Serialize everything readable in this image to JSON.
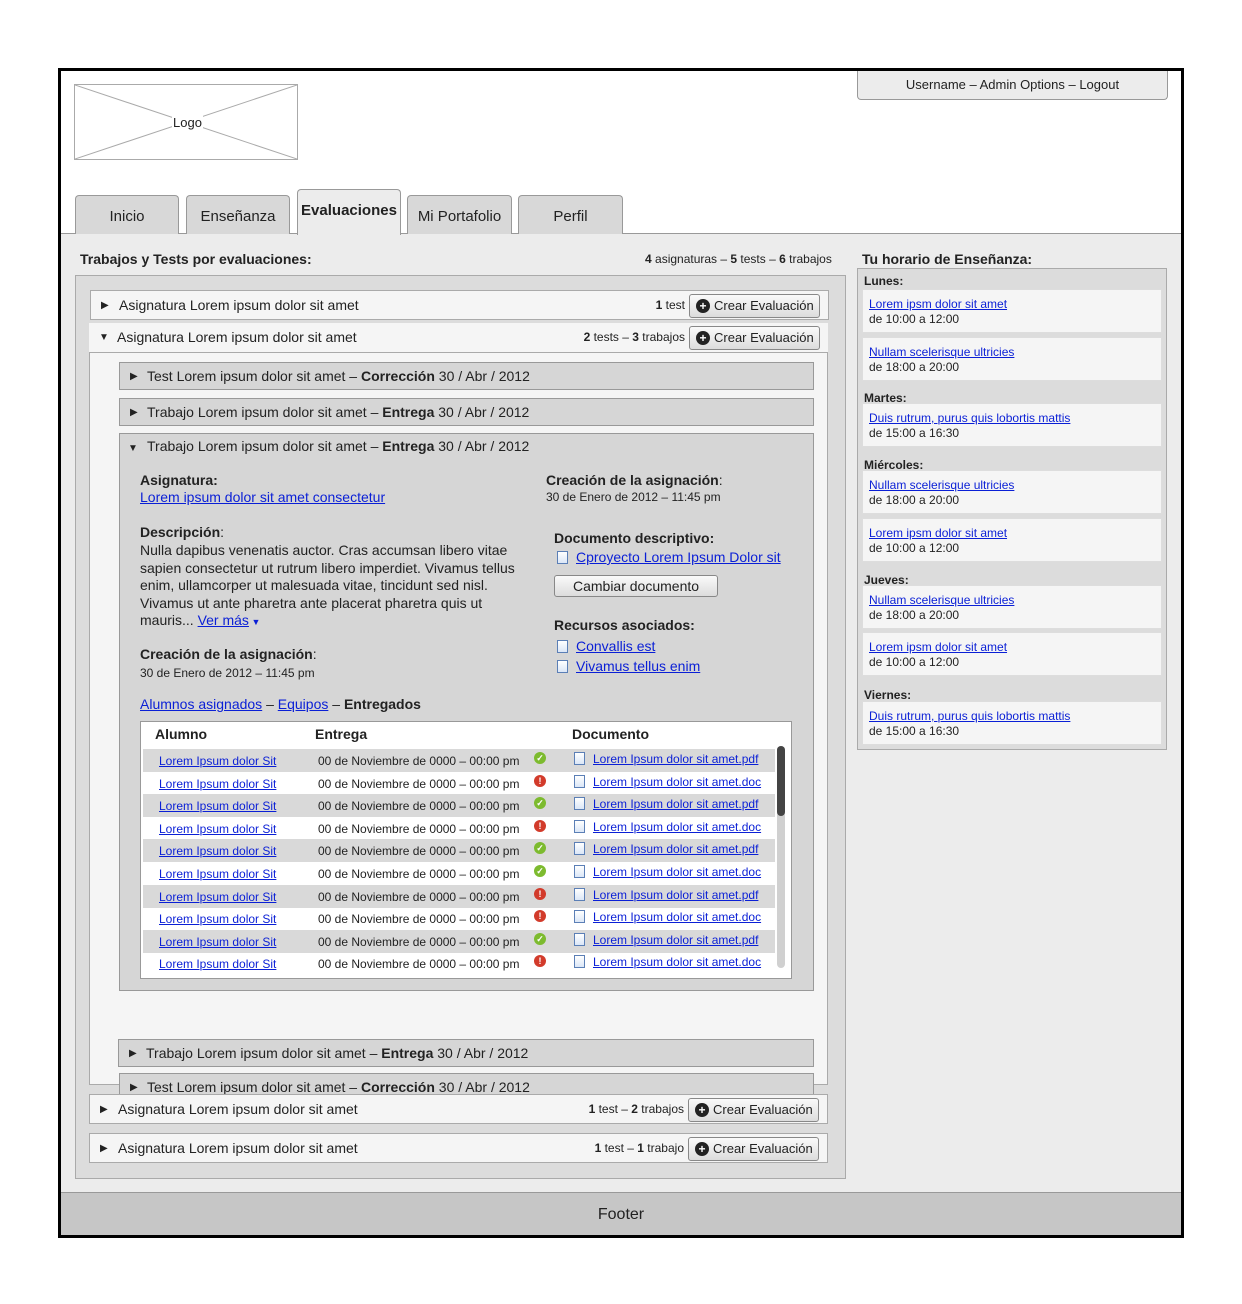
{
  "header": {
    "logo_label": "Logo",
    "user_links": "Username – Admin Options – Logout"
  },
  "tabs": [
    {
      "label": "Inicio"
    },
    {
      "label": "Enseñanza"
    },
    {
      "label": "Evaluaciones"
    },
    {
      "label": "Mi Portafolio"
    },
    {
      "label": "Perfil"
    }
  ],
  "main": {
    "title": "Trabajos y Tests por evaluaciones:",
    "summary": {
      "n1": "4",
      "t1": " asignaturas – ",
      "n2": "5",
      "t2": " tests – ",
      "n3": "6",
      "t3": " trabajos"
    },
    "subjects": [
      {
        "title": "Asignatura Lorem ipsum dolor sit amet",
        "n1": "1",
        "t1": " test",
        "n2": "",
        "t2": "",
        "button": "Crear Evaluación"
      },
      {
        "title": "Asignatura Lorem ipsum dolor sit amet",
        "n1": "2",
        "t1": " tests – ",
        "n2": "3",
        "t2": " trabajos",
        "button": "Crear Evaluación"
      },
      {
        "title": "Asignatura Lorem ipsum dolor sit amet",
        "n1": "1",
        "t1": " test – ",
        "n2": "2",
        "t2": " trabajos",
        "button": "Crear Evaluación"
      },
      {
        "title": "Asignatura Lorem ipsum dolor sit amet",
        "n1": "1",
        "t1": " test – ",
        "n2": "1",
        "t2": " trabajo",
        "button": "Crear Evaluación"
      }
    ],
    "items": [
      {
        "prefix": "Test Lorem ipsum dolor sit amet – ",
        "kind": "Corrección",
        "date": " 30 / Abr / 2012"
      },
      {
        "prefix": "Trabajo Lorem ipsum dolor sit amet – ",
        "kind": "Entrega",
        "date": " 30 / Abr / 2012"
      },
      {
        "prefix": "Test Lorem ipsum dolor sit amet – ",
        "kind": "Corrección",
        "date": " 30 / Abr / 2012"
      },
      {
        "prefix": "Trabajo Lorem ipsum dolor sit amet – ",
        "kind": "Entrega",
        "date": " 30 / Abr / 2012"
      }
    ],
    "detail": {
      "prefix": "Trabajo Lorem ipsum dolor sit amet  – ",
      "kind": "Entrega",
      "date": " 30 / Abr / 2012",
      "asignatura_label": "Asignatura:",
      "asignatura_link": "Lorem ipsum dolor sit amet consectetur",
      "descripcion_label": "Descripción",
      "descripcion_text": "Nulla dapibus venenatis auctor. Cras accumsan libero vitae sapien consectetur ut rutrum libero imperdiet. Vivamus tellus enim, ullamcorper ut malesuada vitae, tincidunt sed nisl. Vivamus ut ante pharetra ante placerat pharetra quis ut mauris... ",
      "ver_mas": "Ver más",
      "creacion_label": "Creación de la asignación",
      "creacion_date": "30 de Enero de 2012 – 11:45 pm",
      "doc_label": "Documento descriptivo:",
      "doc_link": "Cproyecto Lorem Ipsum Dolor sit",
      "doc_button": "Cambiar documento",
      "recursos_label": "Recursos asociados:",
      "recursos": [
        "Convallis est",
        "Vivamus tellus enim"
      ],
      "subtabs": {
        "alumnos": "Alumnos asignados",
        "sep": " – ",
        "equipos": "Equipos",
        "entregados": "Entregados"
      },
      "table": {
        "headers": [
          "Alumno",
          "Entrega",
          "Documento"
        ],
        "rows": [
          {
            "alumno": "Lorem Ipsum dolor Sit",
            "entrega": "00 de Noviembre de 0000 – 00:00 pm",
            "status": "ok",
            "doc": "Lorem Ipsum dolor sit amet.pdf"
          },
          {
            "alumno": "Lorem Ipsum dolor Sit",
            "entrega": "00 de Noviembre de 0000 – 00:00 pm",
            "status": "err",
            "doc": "Lorem Ipsum dolor sit amet.doc"
          },
          {
            "alumno": "Lorem Ipsum dolor Sit",
            "entrega": "00 de Noviembre de 0000 – 00:00 pm",
            "status": "ok",
            "doc": "Lorem Ipsum dolor sit amet.pdf"
          },
          {
            "alumno": "Lorem Ipsum dolor Sit",
            "entrega": "00 de Noviembre de 0000 – 00:00 pm",
            "status": "err",
            "doc": "Lorem Ipsum dolor sit amet.doc"
          },
          {
            "alumno": "Lorem Ipsum dolor Sit",
            "entrega": "00 de Noviembre de 0000 – 00:00 pm",
            "status": "ok",
            "doc": "Lorem Ipsum dolor sit amet.pdf"
          },
          {
            "alumno": "Lorem Ipsum dolor Sit",
            "entrega": "00 de Noviembre de 0000 – 00:00 pm",
            "status": "ok",
            "doc": "Lorem Ipsum dolor sit amet.doc"
          },
          {
            "alumno": "Lorem Ipsum dolor Sit",
            "entrega": "00 de Noviembre de 0000 – 00:00 pm",
            "status": "err",
            "doc": "Lorem Ipsum dolor sit amet.pdf"
          },
          {
            "alumno": "Lorem Ipsum dolor Sit",
            "entrega": "00 de Noviembre de 0000 – 00:00 pm",
            "status": "err",
            "doc": "Lorem Ipsum dolor sit amet.doc"
          },
          {
            "alumno": "Lorem Ipsum dolor Sit",
            "entrega": "00 de Noviembre de 0000 – 00:00 pm",
            "status": "ok",
            "doc": "Lorem Ipsum dolor sit amet.pdf"
          },
          {
            "alumno": "Lorem Ipsum dolor Sit",
            "entrega": "00 de Noviembre de 0000 – 00:00 pm",
            "status": "err",
            "doc": "Lorem Ipsum dolor sit amet.doc"
          }
        ]
      }
    }
  },
  "schedule": {
    "title": "Tu horario de Enseñanza:",
    "days": [
      {
        "name": "Lunes:",
        "slots": [
          {
            "link": "Lorem ipsm dolor sit amet",
            "hours": "de 10:00 a 12:00"
          },
          {
            "link": "Nullam scelerisque ultricies",
            "hours": "de 18:00 a 20:00"
          }
        ]
      },
      {
        "name": "Martes:",
        "slots": [
          {
            "link": "Duis rutrum, purus quis lobortis mattis",
            "hours": "de 15:00 a 16:30"
          }
        ]
      },
      {
        "name": "Miércoles:",
        "slots": [
          {
            "link": "Nullam scelerisque ultricies",
            "hours": "de 18:00 a 20:00"
          },
          {
            "link": "Lorem ipsm dolor sit amet",
            "hours": "de 10:00 a 12:00"
          }
        ]
      },
      {
        "name": "Jueves:",
        "slots": [
          {
            "link": "Nullam scelerisque ultricies",
            "hours": "de 18:00 a 20:00"
          },
          {
            "link": "Lorem ipsm dolor sit amet",
            "hours": "de 10:00 a 12:00"
          }
        ]
      },
      {
        "name": "Viernes:",
        "slots": [
          {
            "link": "Duis rutrum, purus quis lobortis mattis",
            "hours": "de 15:00 a 16:30"
          }
        ]
      }
    ]
  },
  "footer": {
    "label": "Footer"
  }
}
